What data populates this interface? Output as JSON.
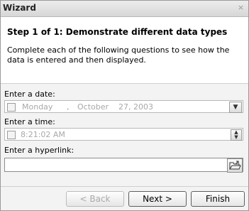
{
  "window": {
    "title": "Wizard",
    "close_glyph": "×"
  },
  "header": {
    "step_title": "Step 1 of 1: Demonstrate different data types",
    "description": "Complete each of the following questions to see how the data is entered and then displayed."
  },
  "fields": {
    "date": {
      "label": "Enter a date:",
      "weekday": "Monday",
      "comma": ",",
      "month": "October",
      "day_year": "27, 2003",
      "checked": false
    },
    "time": {
      "label": "Enter a time:",
      "value": "8:21:02 AM",
      "checked": false
    },
    "hyperlink": {
      "label": "Enter a hyperlink:",
      "value": ""
    }
  },
  "buttons": {
    "back": "< Back",
    "next": "Next >",
    "finish": "Finish"
  },
  "icons": {
    "close": "close-icon",
    "dropdown": "chevron-down-icon",
    "spin": "spin-updown-icon",
    "browse": "folder-open-icon"
  }
}
